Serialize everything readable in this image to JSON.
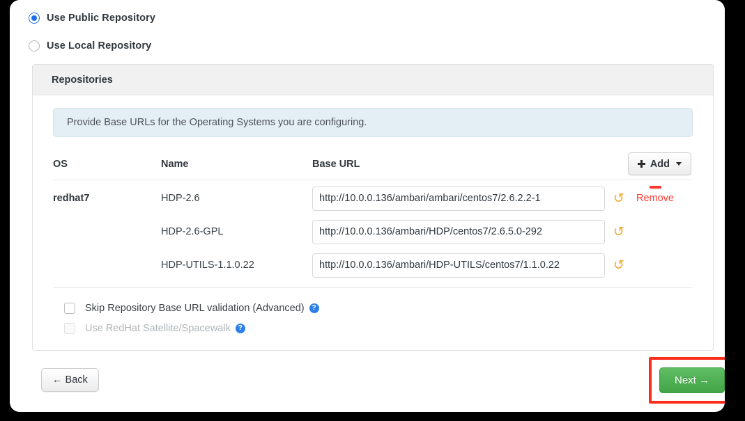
{
  "repository_mode": {
    "options": [
      {
        "label": "Use Public Repository",
        "selected": true
      },
      {
        "label": "Use Local Repository",
        "selected": false
      }
    ]
  },
  "panel": {
    "title": "Repositories",
    "info_message": "Provide Base URLs for the Operating Systems you are configuring."
  },
  "table": {
    "headers": {
      "os": "OS",
      "name": "Name",
      "base_url": "Base URL"
    },
    "add_button": {
      "label": "Add",
      "plus_icon": "plus-icon",
      "caret_icon": "chevron-down-icon"
    },
    "rows": [
      {
        "os": "redhat7",
        "name": "HDP-2.6",
        "base_url": "http://10.0.0.136/ambari/ambari/centos7/2.6.2.2-1",
        "undo_icon": "undo-icon"
      },
      {
        "os": "",
        "name": "HDP-2.6-GPL",
        "base_url": "http://10.0.0.136/ambari/HDP/centos7/2.6.5.0-292",
        "undo_icon": "undo-icon"
      },
      {
        "os": "",
        "name": "HDP-UTILS-1.1.0.22",
        "base_url": "http://10.0.0.136/ambari/HDP-UTILS/centos7/1.1.0.22",
        "undo_icon": "undo-icon"
      }
    ],
    "remove": {
      "label": "Remove",
      "minus_icon": "minus-icon"
    }
  },
  "checkboxes": [
    {
      "label": "Skip Repository Base URL validation (Advanced)",
      "checked": false,
      "disabled": false,
      "help_icon": "help-icon",
      "help_glyph": "?"
    },
    {
      "label": "Use RedHat Satellite/Spacewalk",
      "checked": false,
      "disabled": true,
      "help_icon": "help-icon",
      "help_glyph": "?"
    }
  ],
  "footer": {
    "back_label": "← Back",
    "next_label": "Next →"
  },
  "colors": {
    "accent_blue": "#1e6fe8",
    "help_blue": "#2d7fe8",
    "remove_red": "#fb3b30",
    "highlight_red": "#fb2e1b",
    "next_green": "#41a447",
    "undo_orange": "#f0a830",
    "info_bg": "#e4eff5",
    "panel_head_bg": "#f1f1f1"
  }
}
